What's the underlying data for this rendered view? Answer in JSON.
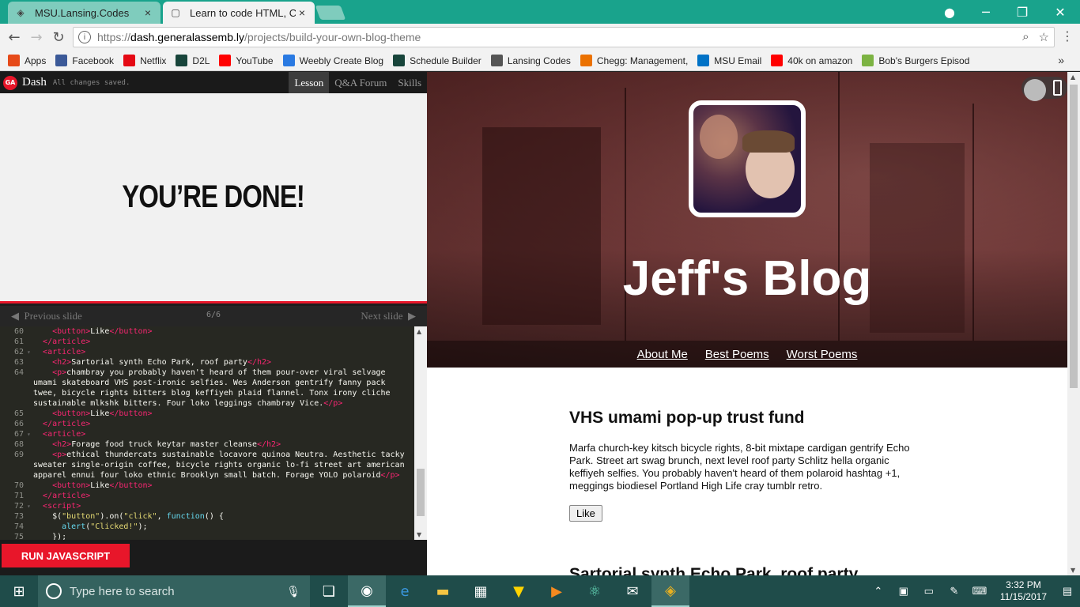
{
  "browser": {
    "tabs": [
      {
        "title": "MSU.Lansing.Codes",
        "close": "×"
      },
      {
        "title": "Learn to code HTML, CSS",
        "close": "×"
      }
    ],
    "url": {
      "scheme": "https://",
      "host": "dash.generalassemb.ly",
      "path": "/projects/build-your-own-blog-theme"
    },
    "bookmarks": [
      {
        "label": "Apps",
        "icon": "apps-grid-icon",
        "color": "#e64a19"
      },
      {
        "label": "Facebook",
        "icon": "facebook-icon",
        "color": "#3b5998"
      },
      {
        "label": "Netflix",
        "icon": "netflix-icon",
        "color": "#e50914"
      },
      {
        "label": "D2L",
        "icon": "d2l-icon",
        "color": "#18453b"
      },
      {
        "label": "YouTube",
        "icon": "youtube-icon",
        "color": "#ff0000"
      },
      {
        "label": "Weebly Create Blog",
        "icon": "weebly-icon",
        "color": "#2a7ae2"
      },
      {
        "label": "Schedule Builder",
        "icon": "spartan-icon",
        "color": "#18453b"
      },
      {
        "label": "Lansing Codes",
        "icon": "lansing-codes-icon",
        "color": "#555555"
      },
      {
        "label": "Chegg: Management,",
        "icon": "chegg-icon",
        "color": "#eb7100"
      },
      {
        "label": "MSU Email",
        "icon": "outlook-icon",
        "color": "#0072c6"
      },
      {
        "label": "40k on amazon",
        "icon": "youtube-icon",
        "color": "#ff0000"
      },
      {
        "label": "Bob's Burgers Episod",
        "icon": "hulu-icon",
        "color": "#7cb342"
      }
    ],
    "bookmarks_more": "»"
  },
  "editor": {
    "brand": "Dash",
    "logo_text": "GA",
    "status": "All changes saved.",
    "tabs": [
      "Lesson",
      "Q&A Forum",
      "Skills"
    ],
    "lesson_heading": "YOU’RE DONE!",
    "prev_slide": "Previous slide",
    "next_slide": "Next slide",
    "slide_counter": "6/6",
    "run_button": "RUN JAVASCRIPT"
  },
  "code_lines": [
    {
      "n": "60",
      "html": "    <span class='tag'>&lt;button&gt;</span>Like<span class='tag'>&lt;/button&gt;</span>"
    },
    {
      "n": "61",
      "html": "  <span class='tag'>&lt;/article&gt;</span>"
    },
    {
      "n": "62",
      "fold": true,
      "html": "  <span class='tag'>&lt;article&gt;</span>"
    },
    {
      "n": "63",
      "html": "    <span class='tag'>&lt;h2&gt;</span>Sartorial synth Echo Park, roof party<span class='tag'>&lt;/h2&gt;</span>"
    },
    {
      "n": "64",
      "html": "    <span class='tag'>&lt;p&gt;</span>chambray you probably haven't heard of them pour-over viral selvage umami skateboard VHS post-ironic selfies. Wes Anderson gentrify fanny pack twee, bicycle rights bitters blog keffiyeh plaid flannel. Tonx irony cliche sustainable mlkshk bitters. Four loko leggings chambray Vice.<span class='tag'>&lt;/p&gt;</span>"
    },
    {
      "n": "65",
      "html": "    <span class='tag'>&lt;button&gt;</span>Like<span class='tag'>&lt;/button&gt;</span>"
    },
    {
      "n": "66",
      "html": "  <span class='tag'>&lt;/article&gt;</span>"
    },
    {
      "n": "67",
      "fold": true,
      "html": "  <span class='tag'>&lt;article&gt;</span>"
    },
    {
      "n": "68",
      "html": "    <span class='tag'>&lt;h2&gt;</span>Forage food truck keytar master cleanse<span class='tag'>&lt;/h2&gt;</span>"
    },
    {
      "n": "69",
      "html": "    <span class='tag'>&lt;p&gt;</span>ethical thundercats sustainable locavore quinoa Neutra. Aesthetic tacky sweater single-origin coffee, bicycle rights organic lo-fi street art american apparel ennui four loko ethnic Brooklyn small batch. Forage YOLO polaroid<span class='tag'>&lt;/p&gt;</span>"
    },
    {
      "n": "70",
      "html": "    <span class='tag'>&lt;button&gt;</span>Like<span class='tag'>&lt;/button&gt;</span>"
    },
    {
      "n": "71",
      "html": "  <span class='tag'>&lt;/article&gt;</span>"
    },
    {
      "n": "72",
      "fold": true,
      "html": "  <span class='tag'>&lt;script&gt;</span>"
    },
    {
      "n": "73",
      "html": "    $(<span class='str'>\"button\"</span>).on(<span class='str'>\"click\"</span>, <span class='fn'>function</span>() {"
    },
    {
      "n": "74",
      "html": "      <span class='fn'>alert</span>(<span class='str'>\"Clicked!\"</span>);"
    },
    {
      "n": "75",
      "html": "    });"
    }
  ],
  "blog": {
    "title": "Jeff's Blog",
    "nav": [
      "About Me",
      "Best Poems",
      "Worst Poems"
    ],
    "posts": [
      {
        "title": "VHS umami pop-up trust fund",
        "body": "Marfa church-key kitsch bicycle rights, 8-bit mixtape cardigan gentrify Echo Park. Street art swag brunch, next level roof party Schlitz hella organic keffiyeh selfies. You probably haven't heard of them polaroid hashtag +1, meggings biodiesel Portland High Life cray tumblr retro.",
        "button": "Like"
      },
      {
        "title": "Sartorial synth Echo Park, roof party"
      }
    ]
  },
  "taskbar": {
    "search_placeholder": "Type here to search",
    "time": "3:32 PM",
    "date": "11/15/2017"
  },
  "colors": {
    "accent": "#e8162a",
    "titlebar": "#19a38c",
    "taskbar": "#1f4c4a"
  }
}
